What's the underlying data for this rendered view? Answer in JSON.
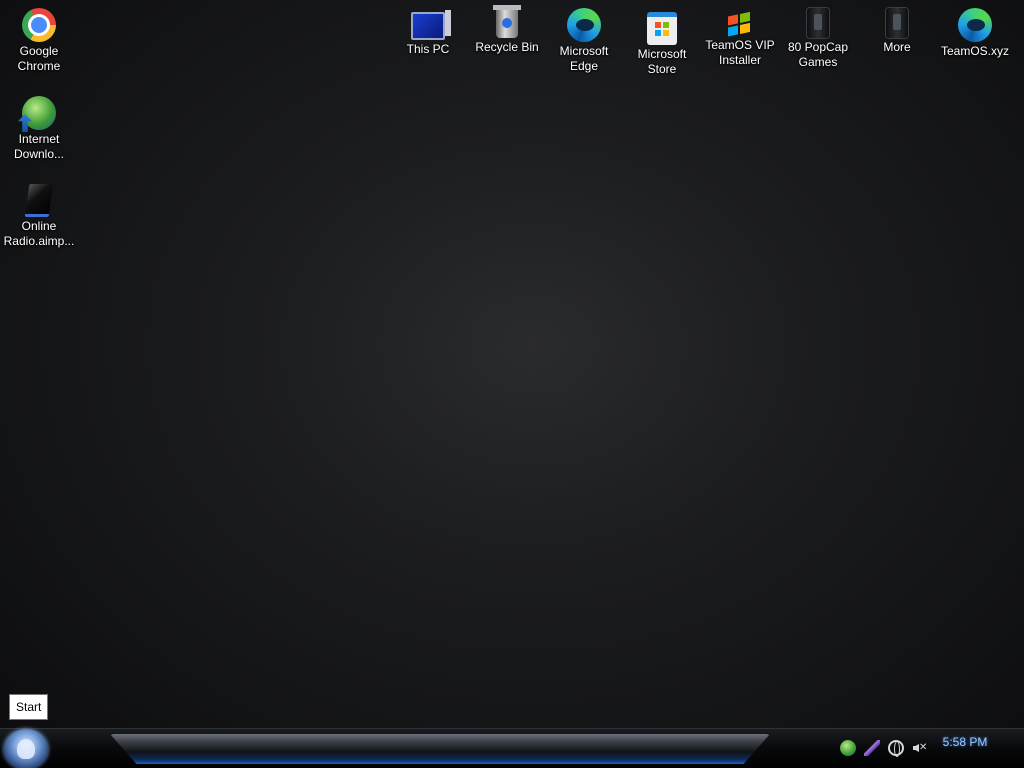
{
  "desktop": {
    "icons": [
      {
        "label": "Google Chrome",
        "icon": "chrome-icon"
      },
      {
        "label": "Internet Downlo...",
        "icon": "internet-download-manager-icon"
      },
      {
        "label": "Online Radio.aimp...",
        "icon": "online-radio-icon"
      },
      {
        "label": "This PC",
        "icon": "computer-icon"
      },
      {
        "label": "Recycle Bin",
        "icon": "recycle-bin-icon"
      },
      {
        "label": "Microsoft Edge",
        "icon": "edge-icon"
      },
      {
        "label": "Microsoft Store",
        "icon": "store-icon"
      },
      {
        "label": "TeamOS VIP Installer",
        "icon": "installer-icon"
      },
      {
        "label": "80 PopCap Games",
        "icon": "folder-icon"
      },
      {
        "label": "More",
        "icon": "folder-icon"
      },
      {
        "label": "TeamOS.xyz",
        "icon": "edge-icon"
      }
    ]
  },
  "tooltip": {
    "text": "Start"
  },
  "taskbar": {
    "clock": "5:58 PM",
    "tray": [
      "internet-download-manager-icon",
      "feather-icon",
      "network-globe-icon",
      "volume-muted-icon"
    ]
  },
  "colors": {
    "desktop_background": "#1c1d20",
    "clock_text": "#9ec9ff",
    "taskbar_accent": "#1c5ec2"
  }
}
